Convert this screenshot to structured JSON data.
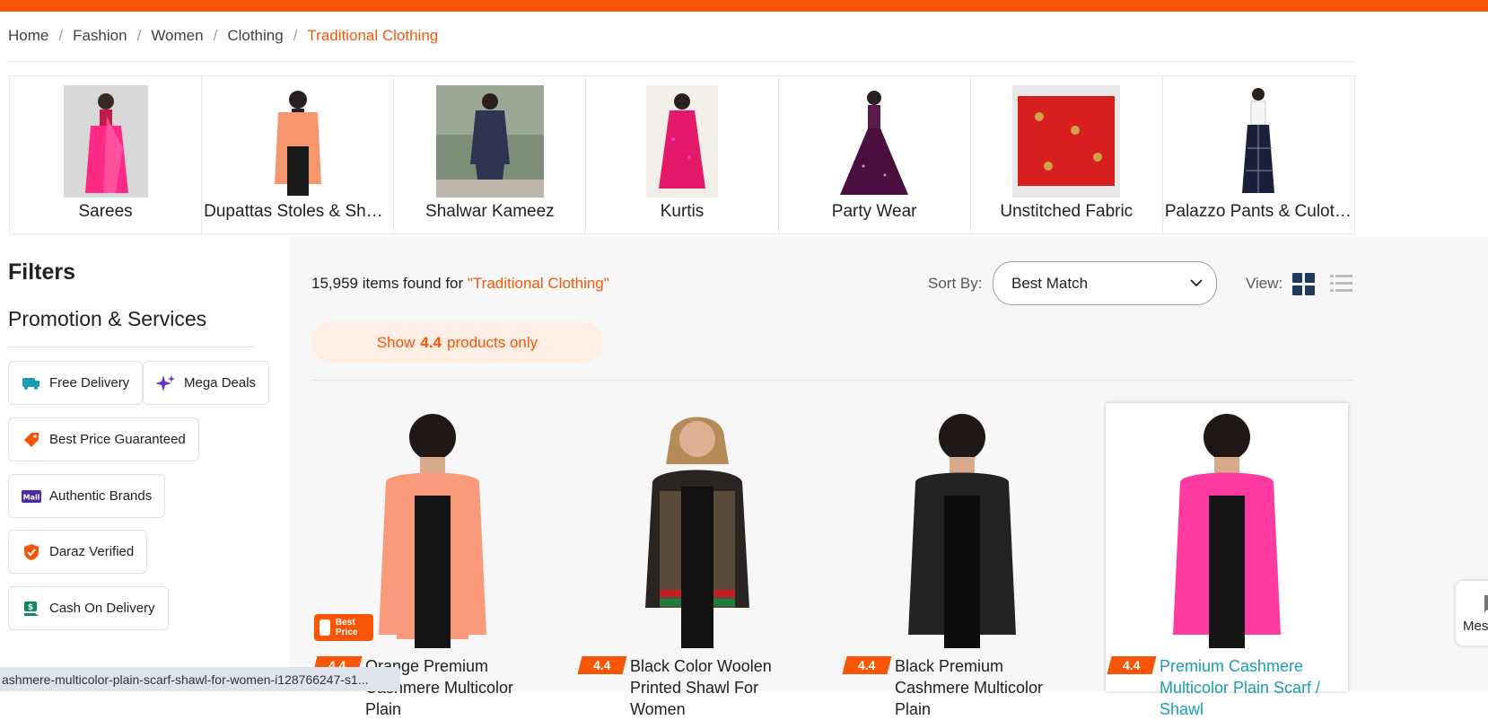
{
  "breadcrumb": [
    "Home",
    "Fashion",
    "Women",
    "Clothing",
    "Traditional Clothing"
  ],
  "categories": [
    {
      "label": "Sarees"
    },
    {
      "label": "Dupattas Stoles & Shawls"
    },
    {
      "label": "Shalwar Kameez"
    },
    {
      "label": "Kurtis"
    },
    {
      "label": "Party Wear"
    },
    {
      "label": "Unstitched Fabric"
    },
    {
      "label": "Palazzo Pants & Culottes"
    }
  ],
  "filters": {
    "title": "Filters",
    "promo_title": "Promotion & Services",
    "chips": [
      "Free Delivery",
      "Mega Deals",
      "Best Price Guaranteed",
      "Authentic Brands",
      "Daraz Verified",
      "Cash On Delivery"
    ]
  },
  "results": {
    "count_text": "15,959 items found for ",
    "query": "\"Traditional Clothing\""
  },
  "sort": {
    "label": "Sort By:",
    "value": "Best Match"
  },
  "view": {
    "label": "View:"
  },
  "show_btn": {
    "prefix": "Show",
    "rating": "4.4",
    "suffix": "products only"
  },
  "products": [
    {
      "rating": "4.4",
      "title": "Orange Premium Cashmere Multicolor Plain",
      "badge": "Best Price"
    },
    {
      "rating": "4.4",
      "title": "Black Color Woolen Printed Shawl For Women"
    },
    {
      "rating": "4.4",
      "title": "Black Premium Cashmere Multicolor Plain"
    },
    {
      "rating": "4.4",
      "title": "Premium Cashmere Multicolor Plain Scarf / Shawl"
    }
  ],
  "status_url": "ashmere-multicolor-plain-scarf-shawl-for-women-i128766247-s1...",
  "message_tab": "Mes",
  "colors": {
    "accent": "#f85606",
    "link": "#1a9cb7"
  }
}
